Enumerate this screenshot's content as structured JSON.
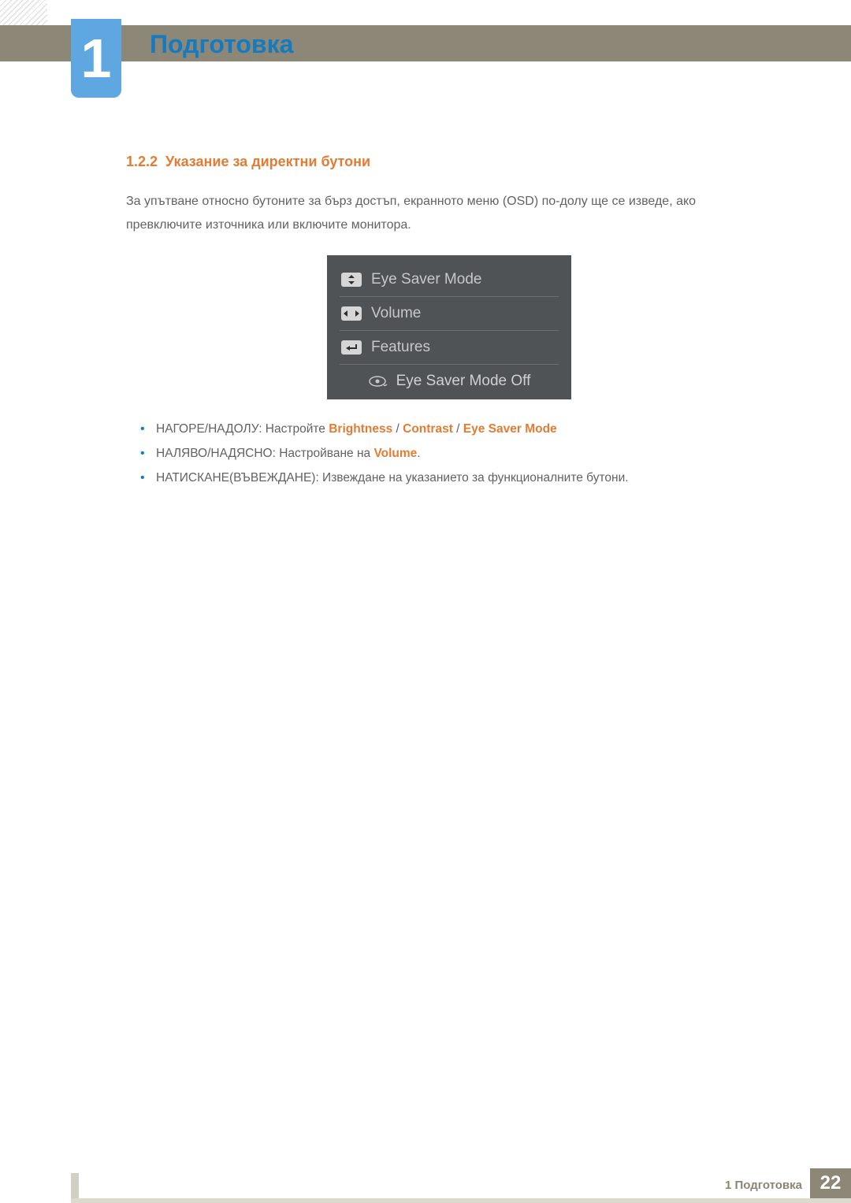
{
  "header": {
    "chapter_number": "1",
    "chapter_title": "Подготовка"
  },
  "section": {
    "number": "1.2.2",
    "title": "Указание за директни бутони",
    "intro": "За упътване относно бутоните за бърз достъп, екранното меню (OSD) по-долу ще се изведе, ако превключите източника или включите монитора."
  },
  "osd": {
    "row1": "Eye Saver Mode",
    "row2": "Volume",
    "row3": "Features",
    "status": "Eye Saver Mode Off"
  },
  "bullets": {
    "b1_prefix": "НАГОРЕ/НАДОЛУ: Настройте ",
    "b1_hl1": "Brightness",
    "b1_sep1": " / ",
    "b1_hl2": "Contrast",
    "b1_sep2": " / ",
    "b1_hl3": "Eye Saver Mode",
    "b2_prefix": "НАЛЯВО/НАДЯСНО: Настройване на ",
    "b2_hl1": "Volume",
    "b2_suffix": ".",
    "b3": "НАТИСКАНЕ(ВЪВЕЖДАНЕ): Извеждане на указанието за функционалните бутони."
  },
  "footer": {
    "text": "1 Подготовка",
    "page": "22"
  }
}
